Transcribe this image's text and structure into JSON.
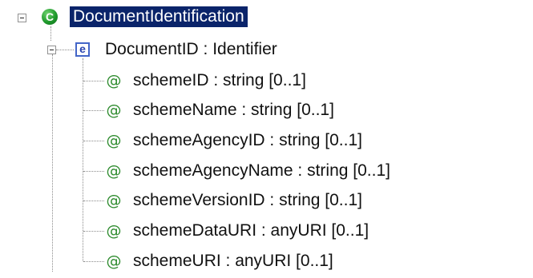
{
  "tree": {
    "root": {
      "icon": "class-icon",
      "icon_glyph": "C",
      "label": "DocumentIdentification",
      "selected": true,
      "expanded": true
    },
    "element": {
      "icon": "element-icon",
      "icon_glyph": "e",
      "label": "DocumentID : Identifier",
      "expanded": true
    },
    "attribute_icon": "attribute-icon",
    "attribute_glyph": "@",
    "attributes": [
      {
        "label": "schemeID : string [0..1]"
      },
      {
        "label": "schemeName : string [0..1]"
      },
      {
        "label": "schemeAgencyID : string [0..1]"
      },
      {
        "label": "schemeAgencyName : string [0..1]"
      },
      {
        "label": "schemeVersionID : string [0..1]"
      },
      {
        "label": "schemeDataURI : anyURI [0..1]"
      },
      {
        "label": "schemeURI : anyURI [0..1]"
      }
    ]
  },
  "colors": {
    "selection_background": "#0a246a",
    "selection_text": "#ffffff",
    "class_icon": "#1f9a2c",
    "element_icon_border": "#4466c8",
    "attribute_icon": "#2e8b2e",
    "tree_lines": "#8a8a8a"
  }
}
